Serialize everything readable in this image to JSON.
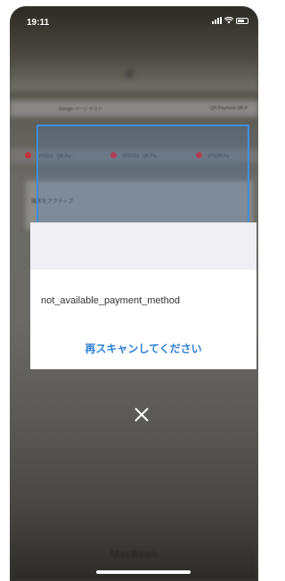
{
  "status_bar": {
    "time": "19:11"
  },
  "background": {
    "tabs": [
      "【FXSD】 QR Pa...",
      "【RSTD】 QR Pa...",
      "【TSQR Pa"
    ],
    "browser_bar": "Google ページ テスト",
    "payment_tab": "QR Payment QR P",
    "screen_heading": "端末をアクティブ",
    "brand": "MacBook"
  },
  "dialog": {
    "message": "not_available_payment_method",
    "rescan_label": "再スキャンしてください"
  },
  "icons": {
    "close": "close-icon"
  },
  "colors": {
    "accent": "#2b7fd6",
    "scan_frame": "#3f8ee0",
    "dialog_header": "#efeff4"
  }
}
